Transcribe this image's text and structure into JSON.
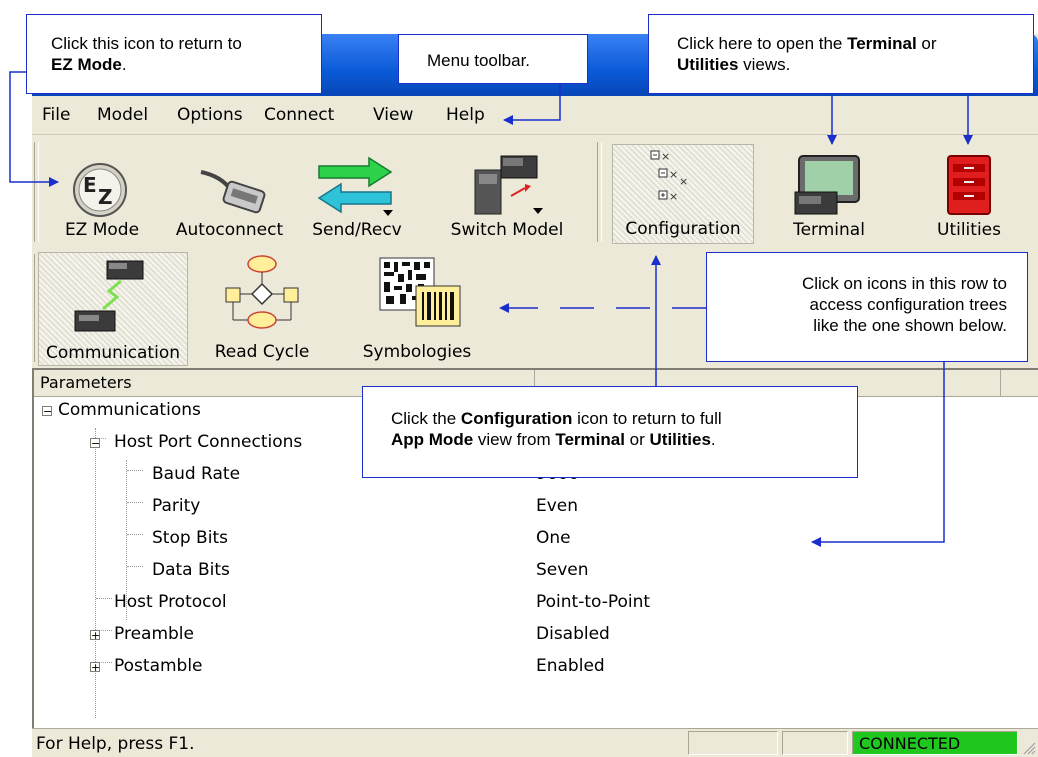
{
  "menu": [
    "File",
    "Model",
    "Options",
    "Connect",
    "View",
    "Help"
  ],
  "toolbar": {
    "ez_mode": "EZ Mode",
    "autoconnect": "Autoconnect",
    "send_recv": "Send/Recv",
    "switch_model": "Switch Model",
    "configuration": "Configuration",
    "terminal": "Terminal",
    "utilities": "Utilities"
  },
  "config_toolbar": {
    "communication": "Communication",
    "read_cycle": "Read Cycle",
    "symbologies": "Symbologies"
  },
  "tree": {
    "header": "Parameters",
    "rows": [
      {
        "label": "Communications",
        "value": ""
      },
      {
        "label": "Host Port Connections",
        "value": ""
      },
      {
        "label": "Baud Rate",
        "value": "9600"
      },
      {
        "label": "Parity",
        "value": "Even"
      },
      {
        "label": "Stop Bits",
        "value": "One"
      },
      {
        "label": "Data Bits",
        "value": "Seven"
      },
      {
        "label": "Host Protocol",
        "value": "Point-to-Point"
      },
      {
        "label": "Preamble",
        "value": "Disabled"
      },
      {
        "label": "Postamble",
        "value": "Enabled"
      }
    ]
  },
  "status": {
    "help": "For Help, press F1.",
    "connection": "CONNECTED",
    "connection_color": "#1fc71f"
  },
  "callouts": {
    "ez_mode": {
      "t1": "Click this icon to return to",
      "b1": "EZ Mode",
      "t2": "."
    },
    "menu": {
      "t1": "Menu toolbar."
    },
    "views": {
      "t1": "Click here to open the ",
      "b1": "Terminal",
      "t2": " or",
      "b2": "Utilities",
      "t3": " views."
    },
    "config_row": {
      "l1": "Click on icons in this row to",
      "l2": "access configuration trees",
      "l3": "like the one shown below."
    },
    "configuration": {
      "t1": "Click the ",
      "b1": "Configuration",
      "t2": " icon to return to full",
      "b2": "App Mode",
      "t3": " view from ",
      "b3": "Terminal",
      "t4": " or ",
      "b4": "Utilities",
      "t5": "."
    }
  },
  "colors": {
    "accent": "#1a2ecc",
    "titlebar": "#0a5ad8"
  }
}
